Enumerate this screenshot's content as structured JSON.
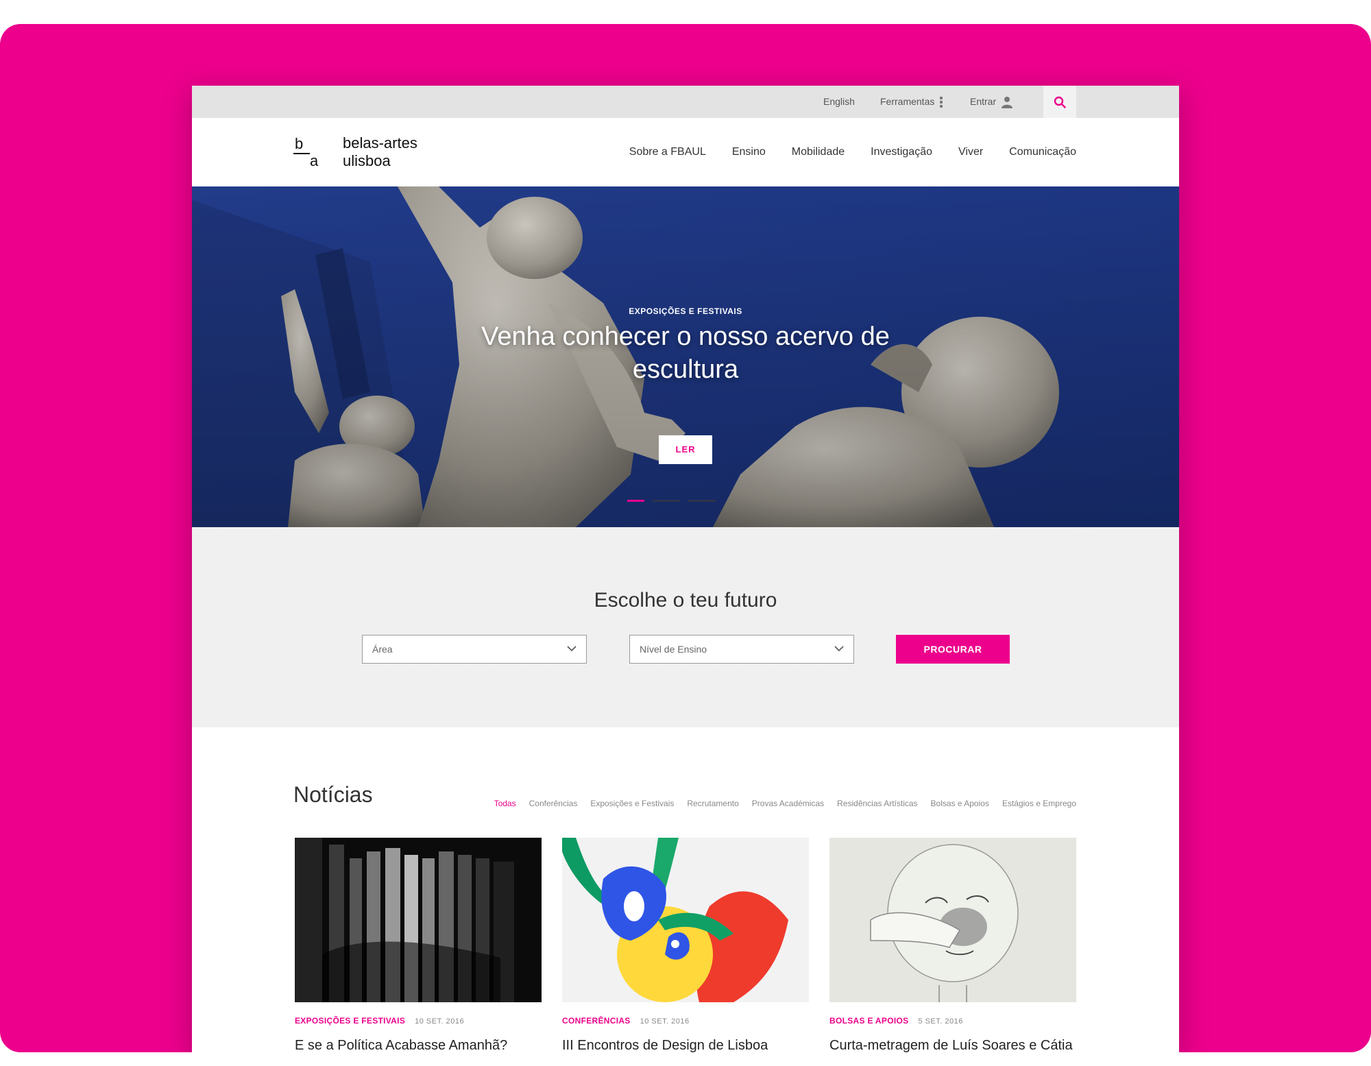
{
  "util": {
    "language": "English",
    "tools": "Ferramentas",
    "login": "Entrar"
  },
  "brand": {
    "mark_b": "b",
    "mark_a": "a",
    "name_line1": "belas-artes",
    "name_line2": "ulisboa"
  },
  "nav": {
    "items": [
      "Sobre a FBAUL",
      "Ensino",
      "Mobilidade",
      "Investigação",
      "Viver",
      "Comunicação"
    ]
  },
  "hero": {
    "kicker": "EXPOSIÇÕES E FESTIVAIS",
    "title": "Venha conhecer o nosso acervo de escultura",
    "button": "LER",
    "slides": 3,
    "active_slide": 1
  },
  "future": {
    "title": "Escolhe o teu futuro",
    "area_placeholder": "Área",
    "level_placeholder": "Nível de Ensino",
    "search_button": "PROCURAR"
  },
  "news": {
    "title": "Notícias",
    "filters": [
      "Todas",
      "Conferências",
      "Exposições e Festivais",
      "Recrutamento",
      "Provas Académicas",
      "Residências Artísticas",
      "Bolsas e Apoios",
      "Estágios e Emprego"
    ],
    "active_filter": "Todas",
    "items": [
      {
        "category": "EXPOSIÇÕES E FESTIVAIS",
        "date": "10 SET. 2016",
        "headline": "E se a Política Acabasse Amanhã?"
      },
      {
        "category": "CONFERÊNCIAS",
        "date": "10 SET. 2016",
        "headline": "III Encontros de Design de Lisboa"
      },
      {
        "category": "BOLSAS E APOIOS",
        "date": "5 SET. 2016",
        "headline": "Curta-metragem de Luís Soares e Cátia"
      }
    ]
  },
  "colors": {
    "accent": "#ec008c",
    "hero_bg": "#1f3a8a",
    "util_bar": "#e3e3e3"
  },
  "icons": [
    "dots-vertical-icon",
    "user-icon",
    "search-icon",
    "chevron-down-icon"
  ]
}
